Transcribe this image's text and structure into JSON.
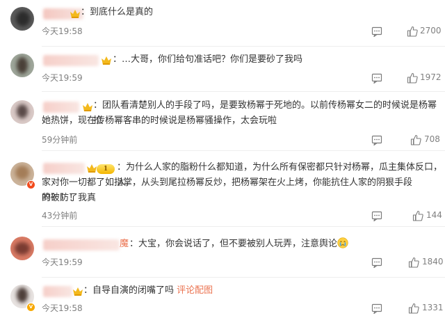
{
  "colors": {
    "link": "#eb7350",
    "meta": "#808080",
    "text": "#333333"
  },
  "comments": [
    {
      "text": "：到底什么是真的",
      "time": "今天19:58",
      "likes": "2700",
      "reply_icon": "comment-icon",
      "like_icon": "thumb-up-icon"
    },
    {
      "text": "：…大哥，你们给句准话吧？你们是要砂了我吗",
      "time": "今天19:59",
      "likes": "1972"
    },
    {
      "text_line1": "：团队看清楚别人的手段了吗，是要致杨幂于死地的。以前传杨幂女二的时候说是杨幂拉",
      "text_line2": "她热饼，现在传杨幂客串的时候说是杨幂骚操作，太会玩啦",
      "time": "59分钟前",
      "likes": "708"
    },
    {
      "text_line1": "：为什么人家的脂粉什么都知道，为什么所有保密都只针对杨幂，瓜主集体反口，人",
      "text_line2": "家对你一切都了如指掌，从头到尾拉杨幂反炒，把杨幂架在火上烤，你能抗住人家的阴狠手段吗？！！我真",
      "text_line3": "的破防了",
      "time": "43分钟前",
      "likes": "144",
      "level": "1"
    },
    {
      "name_suffix": "魔",
      "text": "：大宝，你会说话了，但不要被别人玩弄，注意舆论",
      "time": "今天19:59",
      "likes": "1840"
    },
    {
      "text": "：自导自演的闭嘴了吗",
      "link": "评论配图",
      "time": "今天19:58",
      "likes": "1331"
    }
  ]
}
